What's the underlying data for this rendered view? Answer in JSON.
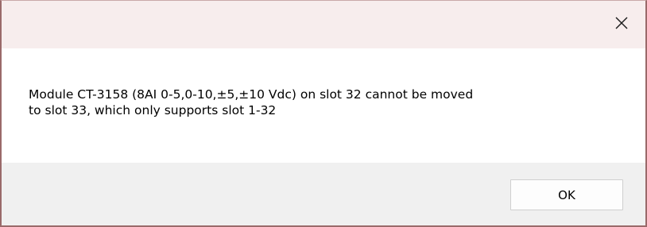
{
  "dialog": {
    "close_icon": "close-icon",
    "message": "Module CT-3158 (8AI 0-5,0-10,±5,±10 Vdc) on slot 32 cannot be moved\nto slot 33, which only supports slot 1-32",
    "ok_label": "OK"
  }
}
